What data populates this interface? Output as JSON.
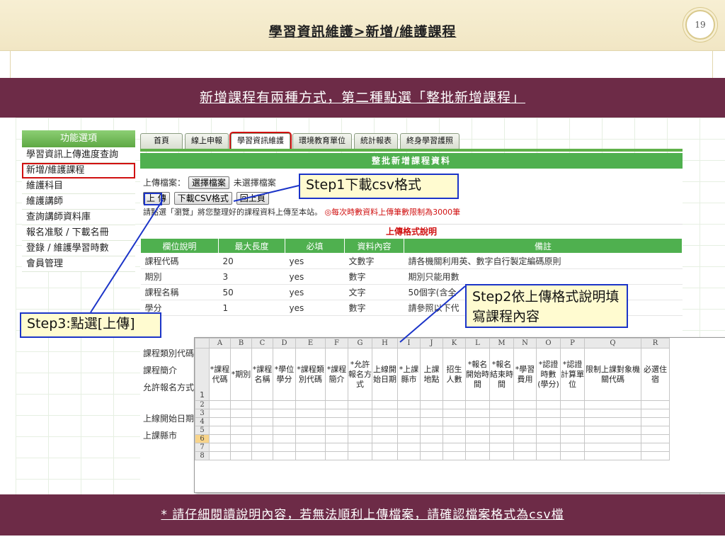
{
  "slide": {
    "title": "學習資訊維護>新增/維護課程",
    "page_number": "19",
    "banner_top": "新增課程有兩種方式，第二種點選「整批新增課程」",
    "banner_bottom": "* 請仔細閱讀說明內容，若無法順利上傳檔案，請確認檔案格式為csv檔"
  },
  "sidebar": {
    "header": "功能選項",
    "items": [
      "學習資訊上傳進度查詢",
      "新增/維護課程",
      "維護科目",
      "維護講師",
      "查詢講師資料庫",
      "報名准駁 / 下載名冊",
      "登錄 / 維護學習時數",
      "會員管理"
    ],
    "active_index": 1
  },
  "tabs": [
    "首頁",
    "線上申報",
    "學習資訊維護",
    "環境教育單位",
    "統計報表",
    "終身學習護照"
  ],
  "panel": {
    "title": "整批新增課程資料",
    "upload_label": "上傳檔案：",
    "choose_file": "選擇檔案",
    "no_file": "未選擇檔案",
    "upload_button": "上 傳",
    "download_csv": "下載CSV格式",
    "back_button": "回上頁",
    "instruction": "請點選「瀏覽」將您整理好的課程資料上傳至本站。",
    "limit_warning": "◎每次時數資料上傳筆數限制為3000筆",
    "format_title": "上傳格式說明",
    "format_headers": [
      "欄位說明",
      "最大長度",
      "必填",
      "資料內容",
      "備註"
    ],
    "format_rows": [
      [
        "課程代碼",
        "20",
        "yes",
        "文數字",
        "請各機關利用英、數字自行製定編碼原則"
      ],
      [
        "期別",
        "3",
        "yes",
        "數字",
        "期別只能用數"
      ],
      [
        "課程名稱",
        "50",
        "yes",
        "文字",
        "50個字(含全"
      ],
      [
        "學分",
        "1",
        "yes",
        "數字",
        "請參照以下代"
      ]
    ],
    "more_labels": [
      "課程類別代碼",
      "課程簡介",
      "允許報名方式",
      "上線開始日期",
      "上課縣市"
    ]
  },
  "excel": {
    "columns": [
      "A",
      "B",
      "C",
      "D",
      "E",
      "F",
      "G",
      "H",
      "I",
      "J",
      "K",
      "L",
      "M",
      "N",
      "O",
      "P",
      "Q",
      "R"
    ],
    "header_row": [
      "*課程代碼",
      "*期別",
      "*課程名稱",
      "*學位學分",
      "*課程類別代碼",
      "*課程簡介",
      "*允許報名方式",
      "上線開始日期",
      "*上課縣市",
      "上課地點",
      "招生人數",
      "*報名開始時間",
      "*報名結束時間",
      "*學習費用",
      "*認證時數(學分)",
      "*認證計算單位",
      "限制上課對象機關代碼",
      "必選住宿"
    ],
    "row_numbers": [
      "1",
      "2",
      "3",
      "4",
      "5",
      "6",
      "7",
      "8"
    ],
    "selected_row": "6"
  },
  "callouts": {
    "step1": "Step1下載csv格式",
    "step2": "Step2依上傳格式說明填寫課程內容",
    "step3": "Step3:點選[上傳]"
  },
  "colors": {
    "banner": "#6d2b47",
    "accent_green": "#4fb04f",
    "highlight_red": "#d01010",
    "callout_blue": "#1b34c8"
  }
}
